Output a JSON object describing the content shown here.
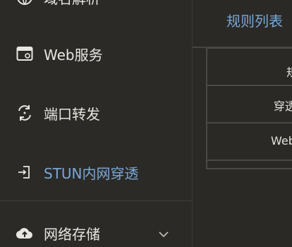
{
  "sidebar": {
    "items": [
      {
        "label": "域名解析",
        "icon": "globe-icon",
        "active": false
      },
      {
        "label": "Web服务",
        "icon": "browser-window-icon",
        "active": false
      },
      {
        "label": "端口转发",
        "icon": "refresh-arrows-icon",
        "active": false
      },
      {
        "label": "STUN内网穿透",
        "icon": "tunnel-arrow-icon",
        "active": true
      },
      {
        "label": "网络存储",
        "icon": "cloud-upload-icon",
        "active": false,
        "expandable": true
      }
    ]
  },
  "main": {
    "title": "规则列表",
    "table": {
      "rows": [
        {
          "text": "规"
        },
        {
          "text": "穿透"
        },
        {
          "text": "Web"
        }
      ]
    }
  },
  "colors": {
    "background": "#2b2a27",
    "text": "#e8e6e1",
    "accent": "#7aa7d6",
    "border": "#4a4944"
  }
}
